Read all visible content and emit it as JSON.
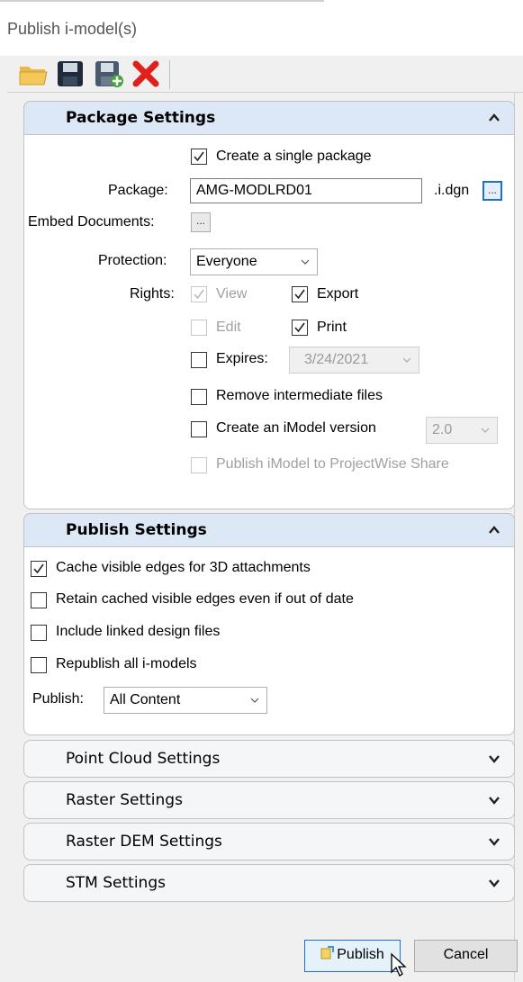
{
  "window": {
    "title": "Publish i-model(s)"
  },
  "toolbar": {
    "items": [
      {
        "name": "open-folder-icon"
      },
      {
        "name": "save-icon"
      },
      {
        "name": "save-as-icon"
      },
      {
        "name": "delete-icon"
      }
    ]
  },
  "package_settings": {
    "header": "Package Settings",
    "expanded": true,
    "create_single_package": {
      "label": "Create a single package",
      "checked": true
    },
    "package": {
      "label": "Package:",
      "value": "AMG-MODLRD01",
      "suffix": ".i.dgn",
      "browse": "..."
    },
    "embed_documents": {
      "label": "Embed Documents:",
      "browse": "..."
    },
    "protection": {
      "label": "Protection:",
      "value": "Everyone"
    },
    "rights": {
      "label": "Rights:",
      "view": {
        "label": "View",
        "checked": true,
        "enabled": false
      },
      "export": {
        "label": "Export",
        "checked": true
      },
      "edit": {
        "label": "Edit",
        "checked": false,
        "enabled": false
      },
      "print": {
        "label": "Print",
        "checked": true
      }
    },
    "expires": {
      "label": "Expires:",
      "checked": false,
      "date": "3/24/2021"
    },
    "remove_intermediate": {
      "label": "Remove intermediate files",
      "checked": false
    },
    "create_imodel_version": {
      "label": "Create an iModel version",
      "checked": false,
      "version": "2.0"
    },
    "publish_projectwise": {
      "label": "Publish iModel to ProjectWise Share",
      "checked": false,
      "enabled": false
    }
  },
  "publish_settings": {
    "header": "Publish Settings",
    "expanded": true,
    "cache_visible_edges": {
      "label": "Cache visible edges for 3D attachments",
      "checked": true
    },
    "retain_cached": {
      "label": "Retain cached visible edges even if out of date",
      "checked": false
    },
    "include_linked": {
      "label": "Include linked design files",
      "checked": false
    },
    "republish_all": {
      "label": "Republish all i-models",
      "checked": false
    },
    "publish": {
      "label": "Publish:",
      "value": "All Content"
    }
  },
  "collapsed_sections": [
    {
      "header": "Point Cloud Settings"
    },
    {
      "header": "Raster Settings"
    },
    {
      "header": "Raster DEM Settings"
    },
    {
      "header": "STM Settings"
    }
  ],
  "buttons": {
    "publish": "Publish",
    "cancel": "Cancel"
  },
  "colors": {
    "accent": "#1e6fd0",
    "header_bg": "#dde8f6",
    "delete_red": "#e0201a"
  }
}
